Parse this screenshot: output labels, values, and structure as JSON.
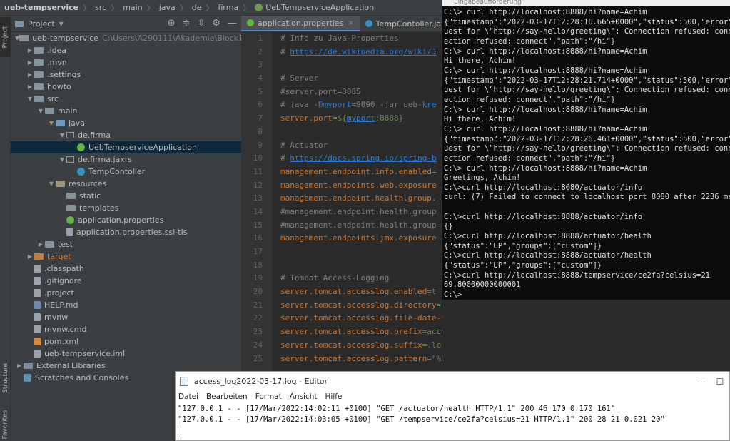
{
  "breadcrumb": [
    "ueb-tempservice",
    "src",
    "main",
    "java",
    "de",
    "firma",
    "UebTempserviceApplication"
  ],
  "left_stripe": {
    "project": "Project",
    "structure": "Structure",
    "favorites": "Favorites"
  },
  "project_panel": {
    "title": "Project",
    "tree": [
      {
        "depth": 0,
        "arrow": "▼",
        "icon": "folder",
        "label": "ueb-tempservice",
        "path": "C:\\Users\\A290111\\Akademie\\Block11-Micros"
      },
      {
        "depth": 1,
        "arrow": "▶",
        "icon": "folder",
        "label": ".idea"
      },
      {
        "depth": 1,
        "arrow": "▶",
        "icon": "folder",
        "label": ".mvn"
      },
      {
        "depth": 1,
        "arrow": "▶",
        "icon": "folder",
        "label": ".settings"
      },
      {
        "depth": 1,
        "arrow": "▶",
        "icon": "folder",
        "label": "howto"
      },
      {
        "depth": 1,
        "arrow": "▼",
        "icon": "folder",
        "label": "src"
      },
      {
        "depth": 2,
        "arrow": "▼",
        "icon": "folder",
        "label": "main"
      },
      {
        "depth": 3,
        "arrow": "▼",
        "icon": "folder-blue",
        "label": "java"
      },
      {
        "depth": 4,
        "arrow": "▼",
        "icon": "package",
        "label": "de.firma"
      },
      {
        "depth": 5,
        "arrow": "",
        "icon": "spring",
        "label": "UebTempserviceApplication",
        "selected": true
      },
      {
        "depth": 4,
        "arrow": "▼",
        "icon": "package",
        "label": "de.firma.jaxrs"
      },
      {
        "depth": 5,
        "arrow": "",
        "icon": "class",
        "label": "TempContoller"
      },
      {
        "depth": 3,
        "arrow": "▼",
        "icon": "folder-res",
        "label": "resources"
      },
      {
        "depth": 4,
        "arrow": "",
        "icon": "folder",
        "label": "static"
      },
      {
        "depth": 4,
        "arrow": "",
        "icon": "folder",
        "label": "templates"
      },
      {
        "depth": 4,
        "arrow": "",
        "icon": "spring",
        "label": "application.properties"
      },
      {
        "depth": 4,
        "arrow": "",
        "icon": "file",
        "label": "application.properties.ssl-tls"
      },
      {
        "depth": 2,
        "arrow": "▶",
        "icon": "folder",
        "label": "test"
      },
      {
        "depth": 1,
        "arrow": "▶",
        "icon": "folder-target",
        "label": "target",
        "red": true
      },
      {
        "depth": 1,
        "arrow": "",
        "icon": "file",
        "label": ".classpath"
      },
      {
        "depth": 1,
        "arrow": "",
        "icon": "file",
        "label": ".gitignore"
      },
      {
        "depth": 1,
        "arrow": "",
        "icon": "file",
        "label": ".project"
      },
      {
        "depth": 1,
        "arrow": "",
        "icon": "md",
        "label": "HELP.md"
      },
      {
        "depth": 1,
        "arrow": "",
        "icon": "file",
        "label": "mvnw"
      },
      {
        "depth": 1,
        "arrow": "",
        "icon": "file",
        "label": "mvnw.cmd"
      },
      {
        "depth": 1,
        "arrow": "",
        "icon": "xml",
        "label": "pom.xml"
      },
      {
        "depth": 1,
        "arrow": "",
        "icon": "file",
        "label": "ueb-tempservice.iml"
      },
      {
        "depth": 0,
        "arrow": "▶",
        "icon": "folder-lib",
        "label": "External Libraries"
      },
      {
        "depth": 0,
        "arrow": "",
        "icon": "scratch",
        "label": "Scratches and Consoles"
      }
    ]
  },
  "editor": {
    "tabs": [
      {
        "label": "application.properties",
        "active": true
      },
      {
        "label": "TempContoller.java",
        "active": false
      }
    ],
    "line_numbers": [
      "1",
      "2",
      "3",
      "4",
      "5",
      "6",
      "7",
      "8",
      "9",
      "10",
      "11",
      "12",
      "13",
      "14",
      "15",
      "16",
      "17",
      "18",
      "19",
      "20",
      "21",
      "22",
      "23",
      "24",
      "25"
    ],
    "lines": [
      [
        {
          "t": "# Info zu Java-Properties",
          "c": "c"
        }
      ],
      [
        {
          "t": "# ",
          "c": "c"
        },
        {
          "t": "https://de.wikipedia.org/wiki/J",
          "c": "u"
        }
      ],
      [],
      [
        {
          "t": "# Server",
          "c": "c"
        }
      ],
      [
        {
          "t": "#server.port=8085",
          "c": "c"
        }
      ],
      [
        {
          "t": "# java -",
          "c": "c"
        },
        {
          "t": "Dmyport",
          "c": "cu"
        },
        {
          "t": "=9090 -jar ueb-",
          "c": "c"
        },
        {
          "t": "kre",
          "c": "cu"
        }
      ],
      [
        {
          "t": "server.port",
          "c": "k"
        },
        {
          "t": "=${",
          "c": "v"
        },
        {
          "t": "myport",
          "c": "vu"
        },
        {
          "t": ":8888}",
          "c": "v"
        }
      ],
      [],
      [
        {
          "t": "# Actuator",
          "c": "c"
        }
      ],
      [
        {
          "t": "# ",
          "c": "c"
        },
        {
          "t": "https://docs.spring.io/spring-b",
          "c": "u"
        }
      ],
      [
        {
          "t": "management.endpoint.info.enabled=",
          "c": "k"
        }
      ],
      [
        {
          "t": "management.endpoints.web.exposure",
          "c": "k"
        }
      ],
      [
        {
          "t": "management.endpoint.health.group.",
          "c": "k"
        }
      ],
      [
        {
          "t": "#management.endpoint.health.group",
          "c": "c"
        }
      ],
      [
        {
          "t": "#management.endpoint.health.group",
          "c": "c"
        }
      ],
      [
        {
          "t": "management.endpoints.jmx.exposure",
          "c": "k"
        }
      ],
      [],
      [],
      [
        {
          "t": "# Tomcat Access-Logging",
          "c": "c"
        }
      ],
      [
        {
          "t": "server.tomcat.accesslog.enabled",
          "c": "k"
        },
        {
          "t": "=t",
          "c": "v"
        }
      ],
      [
        {
          "t": "server.tomcat.accesslog.directory",
          "c": "k"
        },
        {
          "t": "=c:/tmp/logs",
          "c": "v"
        }
      ],
      [
        {
          "t": "server.tomcat.accesslog.file-date-format",
          "c": "k"
        },
        {
          "t": "=yyyy-MM-dd",
          "c": "v"
        }
      ],
      [
        {
          "t": "server.tomcat.accesslog.prefix",
          "c": "k"
        },
        {
          "t": "=access_log",
          "c": "v"
        }
      ],
      [
        {
          "t": "server.tomcat.accesslog.suffix",
          "c": "k"
        },
        {
          "t": "=.log",
          "c": "v"
        }
      ],
      [
        {
          "t": "server.tomcat.accesslog.pattern",
          "c": "k"
        },
        {
          "t": "=\"%h %l %u %t \\\"%r\\\" %s %b %D %T %F\"",
          "c": "v"
        }
      ]
    ]
  },
  "cmd": {
    "title": "Eingabeaufforderung",
    "lines": [
      "C:\\> curl http://localhost:8888/hi?name=Achim",
      "{\"timestamp\":\"2022-03-17T12:28:16.665+0000\",\"status\":500,\"error\":\"",
      "uest for \\\"http://say-hello/greeting\\\": Connection refused: connec",
      "ection refused: connect\",\"path\":\"/hi\"}",
      "C:\\> curl http://localhost:8888/hi?name=Achim",
      "Hi there, Achim!",
      "C:\\> curl http://localhost:8888/hi?name=Achim",
      "{\"timestamp\":\"2022-03-17T12:28:21.714+0000\",\"status\":500,\"error\":\"",
      "uest for \\\"http://say-hello/greeting\\\": Connection refused: connec",
      "ection refused: connect\",\"path\":\"/hi\"}",
      "C:\\> curl http://localhost:8888/hi?name=Achim",
      "Hi there, Achim!",
      "C:\\> curl http://localhost:8888/hi?name=Achim",
      "{\"timestamp\":\"2022-03-17T12:28:26.461+0000\",\"status\":500,\"error\":\"",
      "uest for \\\"http://say-hello/greeting\\\": Connection refused: connec",
      "ection refused: connect\",\"path\":\"/hi\"}",
      "C:\\> curl http://localhost:8888/hi?name=Achim",
      "Greetings, Achim!",
      "C:\\>curl http://localhost:8080/actuator/info",
      "curl: (7) Failed to connect to localhost port 8080 after 2236 ms:",
      "",
      "C:\\>curl http://localhost:8888/actuator/info",
      "{}",
      "C:\\>curl http://localhost:8888/actuator/health",
      "{\"status\":\"UP\",\"groups\":[\"custom\"]}",
      "C:\\>curl http://localhost:8888/actuator/health",
      "{\"status\":\"UP\",\"groups\":[\"custom\"]}",
      "C:\\>curl http://localhost:8888/tempservice/ce2fa?celsius=21",
      "69.80000000000001",
      "C:\\>"
    ]
  },
  "notepad": {
    "title": "access_log2022-03-17.log - Editor",
    "menu": [
      "Datei",
      "Bearbeiten",
      "Format",
      "Ansicht",
      "Hilfe"
    ],
    "lines": [
      "\"127.0.0.1 - - [17/Mar/2022:14:02:11 +0100] \"GET /actuator/health HTTP/1.1\" 200 46 170 0.170 161\"",
      "\"127.0.0.1 - - [17/Mar/2022:14:03:05 +0100] \"GET /tempservice/ce2fa?celsius=21 HTTP/1.1\" 200 28 21 0.021 20\""
    ],
    "minimize": "—",
    "maximize": "☐"
  },
  "colors": {
    "accent": "#4a88c7",
    "selection": "#0d293e",
    "ide_bg": "#2b2b2b"
  }
}
